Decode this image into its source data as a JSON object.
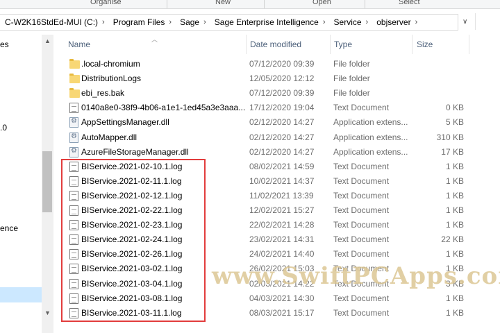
{
  "ribbon": {
    "groups": [
      "Organise",
      "New",
      "Open",
      "Select"
    ]
  },
  "address": {
    "crumbs": [
      "C-W2K16StdEd-MUI (C:)",
      "Program Files",
      "Sage",
      "Sage Enterprise Intelligence",
      "Service",
      "objserver"
    ]
  },
  "nav": {
    "items": [
      "es",
      ".0",
      "ence"
    ]
  },
  "columns": {
    "name": "Name",
    "date": "Date modified",
    "type": "Type",
    "size": "Size"
  },
  "files": [
    {
      "icon": "folder-icon",
      "name": ".local-chromium",
      "date": "07/12/2020 09:39",
      "type": "File folder",
      "size": ""
    },
    {
      "icon": "folder-icon",
      "name": "DistributionLogs",
      "date": "12/05/2020 12:12",
      "type": "File folder",
      "size": ""
    },
    {
      "icon": "folder-icon",
      "name": "ebi_res.bak",
      "date": "07/12/2020 09:39",
      "type": "File folder",
      "size": ""
    },
    {
      "icon": "text-document-icon",
      "name": "0140a8e0-38f9-4b06-a1e1-1ed45a3e3aaa...",
      "date": "17/12/2020 19:04",
      "type": "Text Document",
      "size": "0 KB"
    },
    {
      "icon": "dll-icon",
      "name": "AppSettingsManager.dll",
      "date": "02/12/2020 14:27",
      "type": "Application extens...",
      "size": "5 KB"
    },
    {
      "icon": "dll-icon",
      "name": "AutoMapper.dll",
      "date": "02/12/2020 14:27",
      "type": "Application extens...",
      "size": "310 KB"
    },
    {
      "icon": "dll-icon",
      "name": "AzureFileStorageManager.dll",
      "date": "02/12/2020 14:27",
      "type": "Application extens...",
      "size": "17 KB"
    },
    {
      "icon": "text-document-icon",
      "name": "BIService.2021-02-10.1.log",
      "date": "08/02/2021 14:59",
      "type": "Text Document",
      "size": "1 KB"
    },
    {
      "icon": "text-document-icon",
      "name": "BIService.2021-02-11.1.log",
      "date": "10/02/2021 14:37",
      "type": "Text Document",
      "size": "1 KB"
    },
    {
      "icon": "text-document-icon",
      "name": "BIService.2021-02-12.1.log",
      "date": "11/02/2021 13:39",
      "type": "Text Document",
      "size": "1 KB"
    },
    {
      "icon": "text-document-icon",
      "name": "BIService.2021-02-22.1.log",
      "date": "12/02/2021 15:27",
      "type": "Text Document",
      "size": "1 KB"
    },
    {
      "icon": "text-document-icon",
      "name": "BIService.2021-02-23.1.log",
      "date": "22/02/2021 14:28",
      "type": "Text Document",
      "size": "1 KB"
    },
    {
      "icon": "text-document-icon",
      "name": "BIService.2021-02-24.1.log",
      "date": "23/02/2021 14:31",
      "type": "Text Document",
      "size": "22 KB"
    },
    {
      "icon": "text-document-icon",
      "name": "BIService.2021-02-26.1.log",
      "date": "24/02/2021 14:40",
      "type": "Text Document",
      "size": "1 KB"
    },
    {
      "icon": "text-document-icon",
      "name": "BIService.2021-03-02.1.log",
      "date": "26/02/2021 15:03",
      "type": "Text Document",
      "size": "1 KB"
    },
    {
      "icon": "text-document-icon",
      "name": "BIService.2021-03-04.1.log",
      "date": "02/03/2021 14:22",
      "type": "Text Document",
      "size": "3 KB"
    },
    {
      "icon": "text-document-icon",
      "name": "BIService.2021-03-08.1.log",
      "date": "04/03/2021 14:30",
      "type": "Text Document",
      "size": "1 KB"
    },
    {
      "icon": "text-document-icon",
      "name": "BIService.2021-03-11.1.log",
      "date": "08/03/2021 15:17",
      "type": "Text Document",
      "size": "1 KB"
    }
  ],
  "watermark": "www.SwiftPCApps.com",
  "highlight_color": "#e23c3c"
}
